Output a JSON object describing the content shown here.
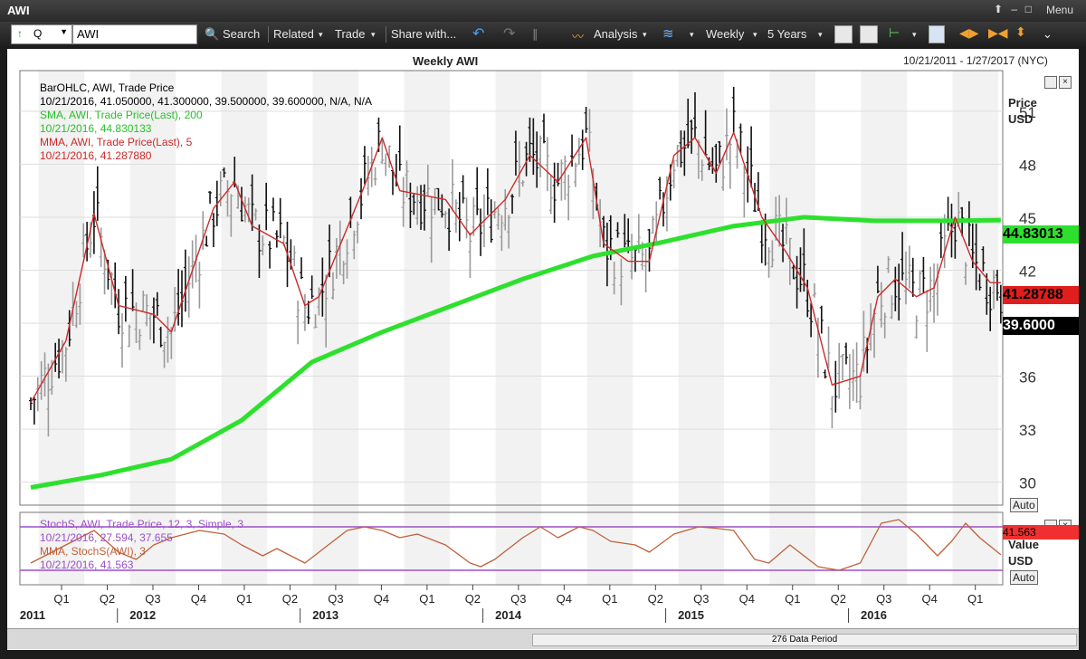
{
  "window": {
    "title": "AWI",
    "menu_label": "Menu"
  },
  "toolbar": {
    "security_type": "Q",
    "symbol": "AWI",
    "search_label": "Search",
    "related_label": "Related",
    "trade_label": "Trade",
    "share_label": "Share with...",
    "analysis_label": "Analysis",
    "period_label": "Weekly",
    "range_label": "5 Years"
  },
  "chart_header": {
    "title": "Weekly AWI",
    "date_range": "10/21/2011 - 1/27/2017 (NYC)"
  },
  "legend": {
    "bar": "BarOHLC, AWI, Trade Price",
    "bar_values": "10/21/2016, 41.050000, 41.300000, 39.500000, 39.600000, N/A, N/A",
    "sma": "SMA, AWI, Trade Price(Last), 200",
    "sma_values": "10/21/2016, 44.830133",
    "mma": "MMA, AWI, Trade Price(Last), 5",
    "mma_values": "10/21/2016, 41.287880",
    "stoch": "StochS, AWI, Trade Price, 12, 3, Simple, 3",
    "stoch_values": "10/21/2016, 27.594, 37.655",
    "stoch_mma": "MMA, StochS(AWI), 3",
    "stoch_mma_values": "10/21/2016, 41.563"
  },
  "axis": {
    "price_label": "Price",
    "currency": "USD",
    "value_label": "Value",
    "auto_label": "Auto"
  },
  "price_tags": {
    "sma": "44.83013",
    "mma": "41.28788",
    "last": "39.6000",
    "stoch": "41.563"
  },
  "status": {
    "periods": "276 Data Period"
  },
  "colors": {
    "sma": "#2ee02e",
    "mma": "#cc2a2a",
    "last": "#000000",
    "stoch_line": "#c0603a",
    "stoch_band": "#9b4fc8"
  },
  "chart_data": [
    {
      "type": "line",
      "title": "Weekly AWI",
      "ylabel": "Price USD",
      "ylim": [
        28.7,
        53.3
      ],
      "y_ticks": [
        30,
        33,
        36,
        39,
        42,
        45,
        48,
        51
      ],
      "x_quarters": [
        "Q1",
        "Q2",
        "Q3",
        "Q4",
        "Q1",
        "Q2",
        "Q3",
        "Q4",
        "Q1",
        "Q2",
        "Q3",
        "Q4",
        "Q1",
        "Q2",
        "Q3",
        "Q4",
        "Q1",
        "Q2",
        "Q3",
        "Q4",
        "Q1"
      ],
      "x_years": [
        "2011",
        "2012",
        "2013",
        "2014",
        "2015",
        "2016"
      ],
      "series": [
        {
          "name": "SMA, AWI, Trade Price(Last), 200",
          "x": [
            0,
            20,
            40,
            60,
            80,
            100,
            120,
            140,
            160,
            180,
            200,
            220,
            240,
            260,
            276
          ],
          "values": [
            29.7,
            30.4,
            31.3,
            33.5,
            36.8,
            38.5,
            40.0,
            41.5,
            42.8,
            43.6,
            44.5,
            45.0,
            44.8,
            44.8,
            44.83
          ]
        },
        {
          "name": "MMA, AWI, Trade Price(Last), 5",
          "x": [
            0,
            10,
            18,
            25,
            35,
            40,
            52,
            58,
            63,
            72,
            78,
            82,
            95,
            100,
            105,
            118,
            125,
            135,
            142,
            150,
            158,
            163,
            170,
            176,
            183,
            189,
            195,
            200,
            208,
            215,
            221,
            228,
            236,
            241,
            246,
            252,
            257,
            263,
            268,
            273,
            276
          ],
          "values": [
            34.5,
            38,
            45.2,
            40,
            39.5,
            38.5,
            45.5,
            47,
            44.5,
            43.5,
            40,
            40.5,
            46.8,
            49.5,
            46.5,
            46,
            44,
            46,
            48.5,
            47,
            49.5,
            43.5,
            42.5,
            42.5,
            48.5,
            49.5,
            47.5,
            49.8,
            45,
            43,
            41,
            35.5,
            36,
            40.5,
            41.5,
            40.5,
            41,
            45,
            42.5,
            41.3,
            41.29
          ]
        },
        {
          "name": "BarOHLC, AWI, Trade Price",
          "last": 39.6
        }
      ]
    },
    {
      "type": "line",
      "title": "StochS, AWI, Trade Price, 12, 3, Simple, 3",
      "ylabel": "Value USD",
      "ylim": [
        0,
        100
      ],
      "bands": [
        80,
        20
      ],
      "series": [
        {
          "name": "MMA, StochS(AWI), 3",
          "x": [
            0,
            10,
            18,
            25,
            30,
            35,
            40,
            48,
            55,
            60,
            66,
            70,
            78,
            82,
            90,
            95,
            100,
            105,
            110,
            118,
            125,
            128,
            132,
            140,
            145,
            150,
            156,
            160,
            165,
            172,
            176,
            183,
            190,
            195,
            200,
            206,
            210,
            216,
            224,
            230,
            236,
            242,
            247,
            252,
            258,
            262,
            266,
            270,
            276
          ],
          "values": [
            30,
            55,
            75,
            45,
            35,
            55,
            65,
            75,
            70,
            55,
            40,
            50,
            30,
            45,
            75,
            80,
            75,
            65,
            70,
            55,
            30,
            25,
            35,
            65,
            80,
            65,
            80,
            75,
            60,
            55,
            45,
            70,
            80,
            78,
            75,
            35,
            30,
            55,
            25,
            20,
            30,
            85,
            90,
            70,
            40,
            60,
            85,
            65,
            41.6
          ]
        }
      ]
    }
  ]
}
